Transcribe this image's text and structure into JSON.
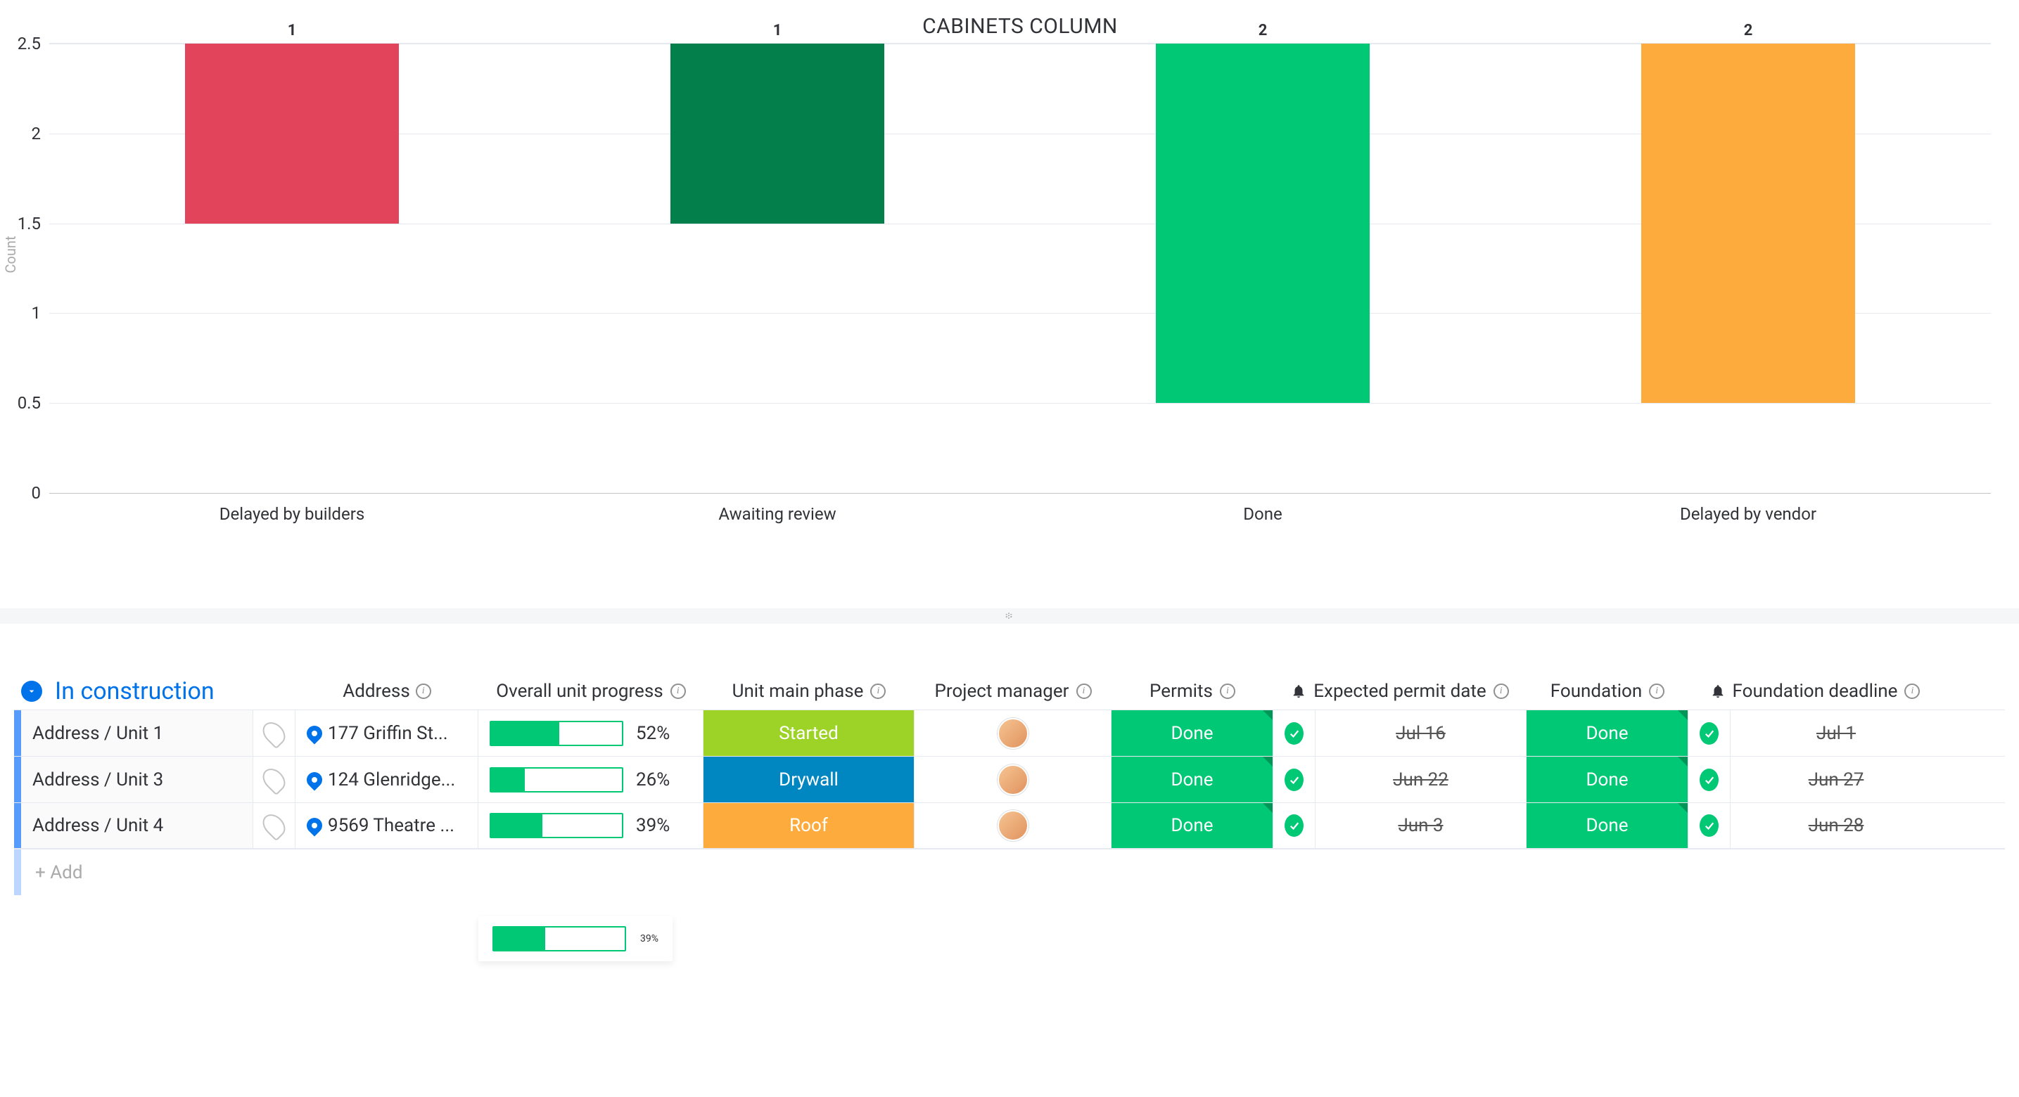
{
  "chart_data": {
    "type": "bar",
    "title": "CABINETS COLUMN",
    "ylabel": "Count",
    "ylim": [
      0,
      2.5
    ],
    "yticks": [
      0,
      0.5,
      1,
      1.5,
      2,
      2.5
    ],
    "categories": [
      "Delayed by builders",
      "Awaiting review",
      "Done",
      "Delayed by vendor"
    ],
    "values": [
      1,
      1,
      2,
      2
    ],
    "colors": [
      "#e2445c",
      "#037f4c",
      "#00c875",
      "#fdab3d"
    ]
  },
  "group": {
    "title": "In construction",
    "color": "#0073ea",
    "columns": {
      "address": "Address",
      "progress": "Overall unit progress",
      "phase": "Unit main phase",
      "pm": "Project manager",
      "permits": "Permits",
      "expected_permit": "Expected permit date",
      "foundation": "Foundation",
      "foundation_deadline": "Foundation deadline"
    },
    "rows": [
      {
        "name": "Address / Unit 1",
        "address": "177 Griffin St...",
        "progress": 52,
        "phase": {
          "label": "Started",
          "color": "#9cd326"
        },
        "permits": {
          "label": "Done",
          "color": "#00c875"
        },
        "permit_date": "Jul 16",
        "foundation": {
          "label": "Done",
          "color": "#00c875"
        },
        "foundation_deadline": "Jul 1"
      },
      {
        "name": "Address / Unit 3",
        "address": "124 Glenridge...",
        "progress": 26,
        "phase": {
          "label": "Drywall",
          "color": "#0086c0"
        },
        "permits": {
          "label": "Done",
          "color": "#00c875"
        },
        "permit_date": "Jun 22",
        "foundation": {
          "label": "Done",
          "color": "#00c875"
        },
        "foundation_deadline": "Jun 27"
      },
      {
        "name": "Address / Unit 4",
        "address": "9569 Theatre ...",
        "progress": 39,
        "phase": {
          "label": "Roof",
          "color": "#fdab3d"
        },
        "permits": {
          "label": "Done",
          "color": "#00c875"
        },
        "permit_date": "Jun 3",
        "foundation": {
          "label": "Done",
          "color": "#00c875"
        },
        "foundation_deadline": "Jun 28"
      }
    ],
    "add_label": "+ Add",
    "summary_progress": 39
  }
}
